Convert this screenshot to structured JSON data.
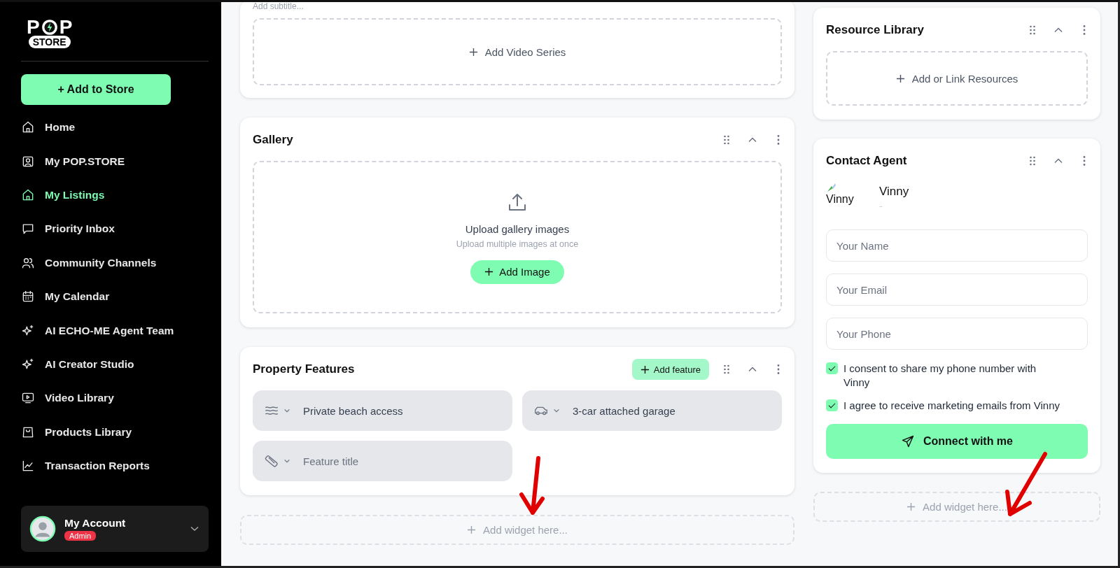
{
  "logo": {
    "letters": [
      "P",
      "P"
    ],
    "badge": "STORE"
  },
  "sidebar": {
    "add_button": "+ Add to Store",
    "items": [
      {
        "label": "Home",
        "selected": false
      },
      {
        "label": "My POP.STORE",
        "selected": false
      },
      {
        "label": "My Listings",
        "selected": true
      },
      {
        "label": "Priority Inbox",
        "selected": false
      },
      {
        "label": "Community Channels",
        "selected": false
      },
      {
        "label": "My Calendar",
        "selected": false
      },
      {
        "label": "AI ECHO-ME Agent Team",
        "selected": false
      },
      {
        "label": "AI Creator Studio",
        "selected": false
      },
      {
        "label": "Video Library",
        "selected": false
      },
      {
        "label": "Products Library",
        "selected": false
      },
      {
        "label": "Transaction Reports",
        "selected": false
      }
    ],
    "account": {
      "name": "My Account",
      "role": "Admin"
    }
  },
  "main": {
    "video_series": {
      "subtitle_placeholder": "Add subtitle...",
      "add_label": "Add Video Series"
    },
    "gallery": {
      "title": "Gallery",
      "upload_title": "Upload gallery images",
      "upload_hint": "Upload multiple images at once",
      "add_button": "Add Image"
    },
    "property_features": {
      "title": "Property Features",
      "add_button": "Add feature",
      "features": [
        {
          "value": "Private beach access"
        },
        {
          "value": "3-car attached garage"
        },
        {
          "placeholder": "Feature title"
        }
      ]
    },
    "add_widget": "Add widget here..."
  },
  "side": {
    "resource_library": {
      "title": "Resource Library",
      "add_label": "Add or Link Resources"
    },
    "contact_agent": {
      "title": "Contact Agent",
      "avatar_alt": "Vinny",
      "agent_name": "Vinny",
      "agent_subtitle": "..",
      "fields": [
        {
          "placeholder": "Your Name"
        },
        {
          "placeholder": "Your Email"
        },
        {
          "placeholder": "Your Phone"
        }
      ],
      "consents": [
        {
          "text": "I consent to share my phone number with Vinny",
          "checked": true
        },
        {
          "text": "I agree to receive marketing emails from Vinny",
          "checked": true
        }
      ],
      "button": "Connect with me"
    },
    "add_widget": "Add widget here..."
  }
}
